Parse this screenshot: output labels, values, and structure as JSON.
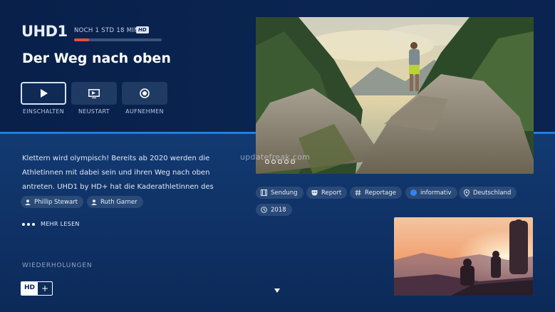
{
  "header": {
    "channel": "UHD1",
    "remaining": "NOCH 1 STD 18 MIN",
    "quality_badge": "HD",
    "progress": 0.17,
    "title": "Der Weg nach oben"
  },
  "actions": [
    {
      "label": "EINSCHALTEN",
      "icon": "play-icon"
    },
    {
      "label": "NEUSTART",
      "icon": "restart-icon"
    },
    {
      "label": "AUFNEHMEN",
      "icon": "record-icon"
    }
  ],
  "hero": {
    "watermark": "updatefreak.com",
    "dot_count": 5
  },
  "description": "Klettern wird olympisch! Bereits ab 2020 werden die Athletinnen mit dabei sein und ihren Weg nach oben antreten. UHD1 by HD+ hat die Kaderathletinnen des",
  "people": [
    "Phillip Stewart",
    "Ruth Garner"
  ],
  "more_label": "MEHR LESEN",
  "tags": [
    {
      "label": "Sendung",
      "icon": "film-icon"
    },
    {
      "label": "Report",
      "icon": "mask-icon"
    },
    {
      "label": "Reportage",
      "icon": "hash-icon"
    },
    {
      "label": "informativ",
      "icon": "dot-icon"
    },
    {
      "label": "Deutschland",
      "icon": "location-icon"
    },
    {
      "label": "2018",
      "icon": "clock-icon"
    }
  ],
  "section_title": "WIEDERHOLUNGEN",
  "hdplus": {
    "hd": "HD",
    "plus": "+"
  },
  "colors": {
    "accent_blue": "#1f7fe0",
    "progress_red": "#e84d3c",
    "informativ_dot": "#2f86f0"
  }
}
